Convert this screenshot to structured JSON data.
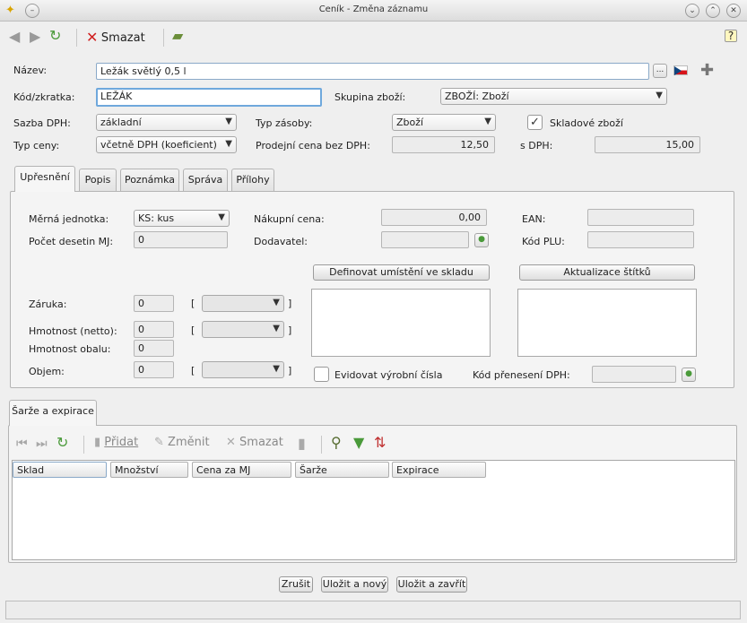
{
  "window": {
    "title": "Ceník - Změna záznamu"
  },
  "toolbar": {
    "delete_label": "Smazat"
  },
  "form": {
    "nazev": {
      "label": "Název:",
      "value": "Ležák světlý 0,5 l",
      "more": "..."
    },
    "kod": {
      "label": "Kód/zkratka:",
      "value": "LEŽÁK"
    },
    "skupina": {
      "label": "Skupina zboží:",
      "value": "ZBOŽÍ: Zboží"
    },
    "sazba_dph": {
      "label": "Sazba DPH:",
      "value": "základní"
    },
    "typ_zasoby": {
      "label": "Typ zásoby:",
      "value": "Zboží"
    },
    "skladove": {
      "label": "Skladové zboží",
      "checked": "✓"
    },
    "typ_ceny": {
      "label": "Typ ceny:",
      "value": "včetně DPH (koeficient)"
    },
    "prodejni": {
      "label": "Prodejní cena bez DPH:",
      "value": "12,50"
    },
    "s_dph": {
      "label": "s DPH:",
      "value": "15,00"
    }
  },
  "tabs": [
    "Upřesnění",
    "Popis",
    "Poznámka",
    "Správa",
    "Přílohy"
  ],
  "upresneni": {
    "merna": {
      "label": "Měrná jednotka:",
      "value": "KS: kus"
    },
    "desetin": {
      "label": "Počet desetin MJ:",
      "value": "0"
    },
    "nakupni": {
      "label": "Nákupní cena:",
      "value": "0,00"
    },
    "dodavatel": {
      "label": "Dodavatel:"
    },
    "ean": {
      "label": "EAN:"
    },
    "kod_plu": {
      "label": "Kód PLU:"
    },
    "definovat_btn": "Definovat umístění ve skladu",
    "aktualizace_btn": "Aktualizace štítků",
    "zaruka": {
      "label": "Záruka:",
      "value": "0"
    },
    "hmotnost": {
      "label": "Hmotnost (netto):",
      "value": "0"
    },
    "obal": {
      "label": "Hmotnost obalu:",
      "value": "0"
    },
    "objem": {
      "label": "Objem:",
      "value": "0"
    },
    "open_bracket": "[",
    "close_bracket": "]",
    "evidovat": {
      "label": "Evidovat výrobní čísla"
    },
    "kod_preneseni": {
      "label": "Kód přenesení DPH:"
    }
  },
  "sarze": {
    "tab": "Šarže a expirace",
    "toolbar": {
      "pridat": "Přidat",
      "zmenit": "Změnit",
      "smazat": "Smazat"
    },
    "columns": [
      "Sklad",
      "Množství",
      "Cena za MJ",
      "Šarže",
      "Expirace"
    ]
  },
  "footer": {
    "zrusit": "Zrušit",
    "ulozit_novy": "Uložit a nový",
    "ulozit_zavrit": "Uložit a zavřít"
  }
}
